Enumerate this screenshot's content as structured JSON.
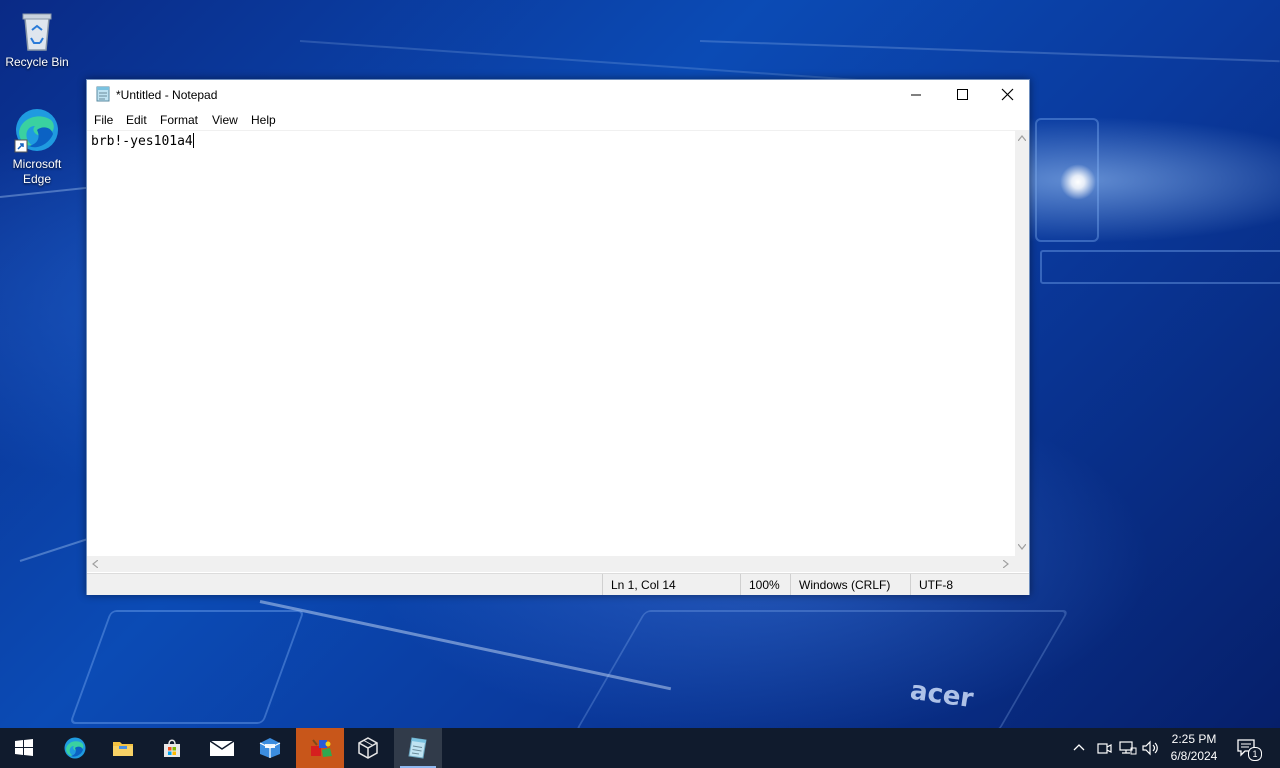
{
  "desktop": {
    "brand_text": "acer",
    "icons": [
      {
        "label": "Recycle Bin",
        "icon": "recycle-bin-icon"
      },
      {
        "label": "Microsoft Edge",
        "icon": "edge-icon"
      }
    ]
  },
  "notepad": {
    "title": "*Untitled - Notepad",
    "menu": [
      "File",
      "Edit",
      "Format",
      "View",
      "Help"
    ],
    "content": "brb!-yes101a4",
    "status": {
      "position": "Ln 1, Col 14",
      "zoom": "100%",
      "line_ending": "Windows (CRLF)",
      "encoding": "UTF-8"
    }
  },
  "taskbar": {
    "apps": [
      {
        "name": "start",
        "icon": "windows-logo-icon"
      },
      {
        "name": "edge",
        "icon": "edge-icon"
      },
      {
        "name": "file-explorer",
        "icon": "folder-icon"
      },
      {
        "name": "store",
        "icon": "store-bag-icon"
      },
      {
        "name": "mail",
        "icon": "mail-icon"
      },
      {
        "name": "app-box",
        "icon": "box-icon"
      },
      {
        "name": "paint-app",
        "icon": "paint-icon"
      },
      {
        "name": "virtualbox",
        "icon": "cube-icon"
      },
      {
        "name": "notepad",
        "icon": "notepad-icon"
      }
    ],
    "clock": {
      "time": "2:25 PM",
      "date": "6/8/2024"
    },
    "notification_count": "1"
  },
  "colors": {
    "taskbar_bg": "#101b2d",
    "active_app_highlight": "#c8561a",
    "window_border": "#6f8fbf"
  }
}
